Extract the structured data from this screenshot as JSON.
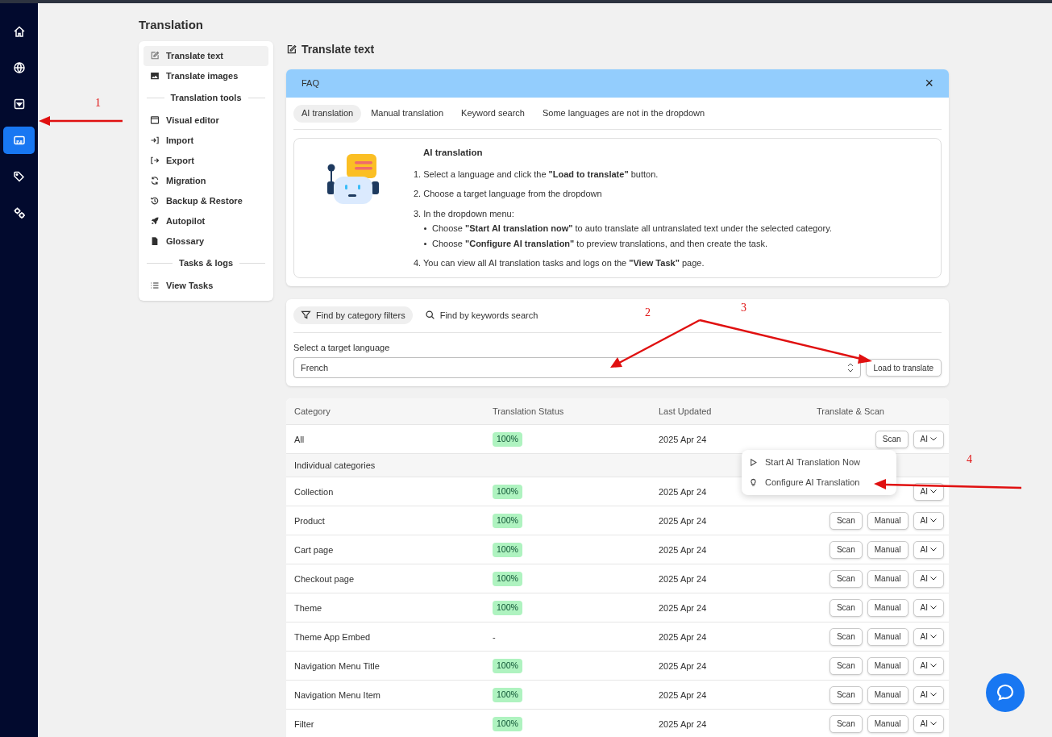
{
  "rail": [
    {
      "kind": "home",
      "selected": false
    },
    {
      "kind": "globe",
      "selected": false
    },
    {
      "kind": "dropdown",
      "selected": false
    },
    {
      "kind": "subtitles",
      "selected": true
    },
    {
      "kind": "tags",
      "selected": false
    },
    {
      "kind": "gears",
      "selected": false
    }
  ],
  "page_title": "Translation",
  "sidebar": [
    {
      "kind": "item",
      "label": "Translate text",
      "selected": true
    },
    {
      "kind": "item",
      "label": "Translate images",
      "selected": false
    },
    {
      "kind": "heading",
      "label": "Translation tools"
    },
    {
      "kind": "item",
      "label": "Visual editor",
      "selected": false
    },
    {
      "kind": "item",
      "label": "Import",
      "selected": false
    },
    {
      "kind": "item",
      "label": "Export",
      "selected": false
    },
    {
      "kind": "item",
      "label": "Migration",
      "selected": false
    },
    {
      "kind": "item",
      "label": "Backup & Restore",
      "selected": false
    },
    {
      "kind": "item",
      "label": "Autopilot",
      "selected": false
    },
    {
      "kind": "item",
      "label": "Glossary",
      "selected": false
    },
    {
      "kind": "heading",
      "label": "Tasks & logs"
    },
    {
      "kind": "item",
      "label": "View Tasks",
      "selected": false
    }
  ],
  "section_title": "Translate text",
  "faq": {
    "title": "FAQ",
    "close": "×",
    "tabs": [
      {
        "label": "AI translation",
        "selected": true
      },
      {
        "label": "Manual translation",
        "selected": false
      },
      {
        "label": "Keyword search",
        "selected": false
      },
      {
        "label": "Some languages are not in the dropdown",
        "selected": false
      }
    ],
    "heading": "AI translation",
    "steps": [
      {
        "text": "1. Select a language and click the **\"Load to translate\"** button."
      },
      {
        "text": "2. Choose a target language from the dropdown"
      },
      {
        "text": "3. In the dropdown menu:",
        "bullets": [
          "Choose **\"Start AI translation now\"** to auto translate all untranslated text under the selected category.",
          "Choose **\"Configure AI translation\"** to preview translations, and then create the task."
        ]
      },
      {
        "text": "4. You can view all AI translation tasks and logs on the **\"View Task\"** page."
      }
    ]
  },
  "filter_tabs": [
    {
      "kind": "filter",
      "label": "Find by category filters",
      "selected": true
    },
    {
      "kind": "search",
      "label": "Find by keywords search",
      "selected": false
    }
  ],
  "language": {
    "label": "Select a target language",
    "value": "French"
  },
  "load_button": "Load to translate",
  "table": {
    "columns": [
      "Category",
      "Translation Status",
      "Last Updated",
      "Translate & Scan"
    ],
    "rows": [
      {
        "kind": "row",
        "category": "All",
        "status": {
          "kind": "badge",
          "text": "100%"
        },
        "updated": "2025 Apr 24",
        "buttons": [
          {
            "kind": "button",
            "label": "Scan"
          },
          {
            "kind": "dropdown",
            "label": "AI"
          }
        ]
      },
      {
        "kind": "group",
        "category": "Individual categories"
      },
      {
        "kind": "row",
        "category": "Collection",
        "status": {
          "kind": "badge",
          "text": "100%"
        },
        "updated": "2025 Apr 24",
        "buttons": [
          {
            "kind": "dropdown",
            "label": "AI"
          }
        ]
      },
      {
        "kind": "row",
        "category": "Product",
        "status": {
          "kind": "badge",
          "text": "100%"
        },
        "updated": "2025 Apr 24",
        "buttons": [
          {
            "kind": "button",
            "label": "Scan"
          },
          {
            "kind": "button",
            "label": "Manual"
          },
          {
            "kind": "dropdown",
            "label": "AI"
          }
        ]
      },
      {
        "kind": "row",
        "category": "Cart page",
        "status": {
          "kind": "badge",
          "text": "100%"
        },
        "updated": "2025 Apr 24",
        "buttons": [
          {
            "kind": "button",
            "label": "Scan"
          },
          {
            "kind": "button",
            "label": "Manual"
          },
          {
            "kind": "dropdown",
            "label": "AI"
          }
        ]
      },
      {
        "kind": "row",
        "category": "Checkout page",
        "status": {
          "kind": "badge",
          "text": "100%"
        },
        "updated": "2025 Apr 24",
        "buttons": [
          {
            "kind": "button",
            "label": "Scan"
          },
          {
            "kind": "button",
            "label": "Manual"
          },
          {
            "kind": "dropdown",
            "label": "AI"
          }
        ]
      },
      {
        "kind": "row",
        "category": "Theme",
        "status": {
          "kind": "badge",
          "text": "100%"
        },
        "updated": "2025 Apr 24",
        "buttons": [
          {
            "kind": "button",
            "label": "Scan"
          },
          {
            "kind": "button",
            "label": "Manual"
          },
          {
            "kind": "dropdown",
            "label": "AI"
          }
        ]
      },
      {
        "kind": "row",
        "category": "Theme App Embed",
        "status": {
          "kind": "text",
          "text": "-"
        },
        "updated": "2025 Apr 24",
        "buttons": [
          {
            "kind": "button",
            "label": "Scan"
          },
          {
            "kind": "button",
            "label": "Manual"
          },
          {
            "kind": "dropdown",
            "label": "AI"
          }
        ]
      },
      {
        "kind": "row",
        "category": "Navigation Menu Title",
        "status": {
          "kind": "badge",
          "text": "100%"
        },
        "updated": "2025 Apr 24",
        "buttons": [
          {
            "kind": "button",
            "label": "Scan"
          },
          {
            "kind": "button",
            "label": "Manual"
          },
          {
            "kind": "dropdown",
            "label": "AI"
          }
        ]
      },
      {
        "kind": "row",
        "category": "Navigation Menu Item",
        "status": {
          "kind": "badge",
          "text": "100%"
        },
        "updated": "2025 Apr 24",
        "buttons": [
          {
            "kind": "button",
            "label": "Scan"
          },
          {
            "kind": "button",
            "label": "Manual"
          },
          {
            "kind": "dropdown",
            "label": "AI"
          }
        ]
      },
      {
        "kind": "row",
        "category": "Filter",
        "status": {
          "kind": "badge",
          "text": "100%"
        },
        "updated": "2025 Apr 24",
        "buttons": [
          {
            "kind": "button",
            "label": "Scan"
          },
          {
            "kind": "button",
            "label": "Manual"
          },
          {
            "kind": "dropdown",
            "label": "AI"
          }
        ]
      }
    ]
  },
  "ai_menu": [
    {
      "kind": "play",
      "label": "Start AI Translation Now"
    },
    {
      "kind": "bulb",
      "label": "Configure AI Translation"
    }
  ],
  "annotations": [
    {
      "label": "1"
    },
    {
      "label": "2"
    },
    {
      "label": "3"
    },
    {
      "label": "4"
    }
  ]
}
